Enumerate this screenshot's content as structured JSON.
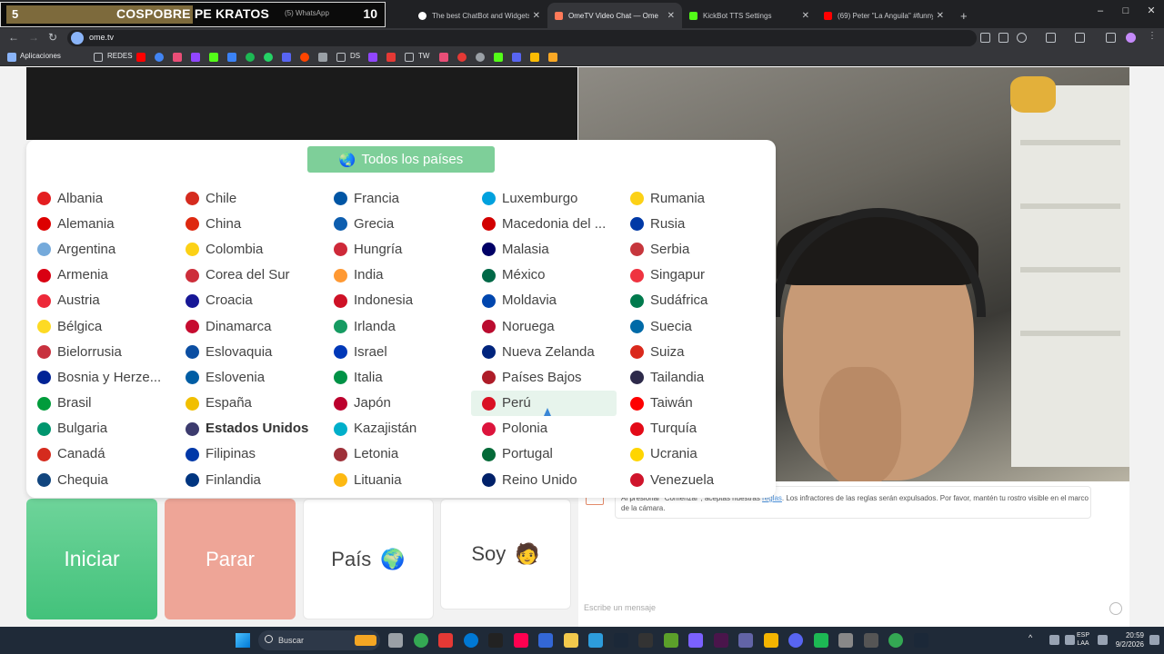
{
  "browser": {
    "tabs": [
      {
        "title": "The best ChatBot and Widgets",
        "fav_color": "#ffffff"
      },
      {
        "title": "OmeTV Video Chat — Ome",
        "fav_color": "#ff7a59",
        "active": true
      },
      {
        "title": "KickBot TTS Settings",
        "fav_color": "#53fc18"
      },
      {
        "title": "(69) Peter \"La Anguila\" #funny",
        "fav_color": "#ff0000"
      }
    ],
    "new_tab": "+",
    "url": "ome.tv",
    "window_controls": [
      "–",
      "□",
      "✕"
    ]
  },
  "stream_overlay": {
    "left_number": "5",
    "title": "COSPOBRE PE KRATOS",
    "whatsapp": "(5) WhatsApp",
    "right_number": "10"
  },
  "bookmarks": {
    "apps": "Aplicaciones",
    "folders": [
      "REDES",
      "DS",
      "TW"
    ]
  },
  "country_selector": {
    "all_button": "Todos los países",
    "all_icon": "🌏",
    "columns": [
      [
        {
          "name": "Albania",
          "flag": "#e41e20"
        },
        {
          "name": "Alemania",
          "flag": "#dd0000"
        },
        {
          "name": "Argentina",
          "flag": "#75aadb"
        },
        {
          "name": "Armenia",
          "flag": "#d90012"
        },
        {
          "name": "Austria",
          "flag": "#ed2939"
        },
        {
          "name": "Bélgica",
          "flag": "#fdda24"
        },
        {
          "name": "Bielorrusia",
          "flag": "#c8313e"
        },
        {
          "name": "Bosnia y Herze...",
          "flag": "#002395"
        },
        {
          "name": "Brasil",
          "flag": "#009c3b"
        },
        {
          "name": "Bulgaria",
          "flag": "#00966e"
        },
        {
          "name": "Canadá",
          "flag": "#d52b1e"
        },
        {
          "name": "Chequia",
          "flag": "#11457e"
        }
      ],
      [
        {
          "name": "Chile",
          "flag": "#d52b1e"
        },
        {
          "name": "China",
          "flag": "#de2910"
        },
        {
          "name": "Colombia",
          "flag": "#fcd116"
        },
        {
          "name": "Corea del Sur",
          "flag": "#cd2e3a"
        },
        {
          "name": "Croacia",
          "flag": "#171796"
        },
        {
          "name": "Dinamarca",
          "flag": "#c60c30"
        },
        {
          "name": "Eslovaquia",
          "flag": "#0b4ea2"
        },
        {
          "name": "Eslovenia",
          "flag": "#005da4"
        },
        {
          "name": "España",
          "flag": "#f1bf00"
        },
        {
          "name": "Estados Unidos",
          "flag": "#3c3b6e",
          "bold": true
        },
        {
          "name": "Filipinas",
          "flag": "#0038a8"
        },
        {
          "name": "Finlandia",
          "flag": "#003580"
        }
      ],
      [
        {
          "name": "Francia",
          "flag": "#0055a4"
        },
        {
          "name": "Grecia",
          "flag": "#0d5eaf"
        },
        {
          "name": "Hungría",
          "flag": "#ce2939"
        },
        {
          "name": "India",
          "flag": "#ff9933"
        },
        {
          "name": "Indonesia",
          "flag": "#ce1126"
        },
        {
          "name": "Irlanda",
          "flag": "#169b62"
        },
        {
          "name": "Israel",
          "flag": "#0038b8"
        },
        {
          "name": "Italia",
          "flag": "#009246"
        },
        {
          "name": "Japón",
          "flag": "#bc002d"
        },
        {
          "name": "Kazajistán",
          "flag": "#00afca"
        },
        {
          "name": "Letonia",
          "flag": "#9e3039"
        },
        {
          "name": "Lituania",
          "flag": "#fdb913"
        }
      ],
      [
        {
          "name": "Luxemburgo",
          "flag": "#00a1de"
        },
        {
          "name": "Macedonia del ...",
          "flag": "#d20000"
        },
        {
          "name": "Malasia",
          "flag": "#010066"
        },
        {
          "name": "México",
          "flag": "#006847"
        },
        {
          "name": "Moldavia",
          "flag": "#0046ae"
        },
        {
          "name": "Noruega",
          "flag": "#ba0c2f"
        },
        {
          "name": "Nueva Zelanda",
          "flag": "#00247d"
        },
        {
          "name": "Países Bajos",
          "flag": "#ae1c28"
        },
        {
          "name": "Perú",
          "flag": "#d91023",
          "highlight": true
        },
        {
          "name": "Polonia",
          "flag": "#dc143c"
        },
        {
          "name": "Portugal",
          "flag": "#046a38"
        },
        {
          "name": "Reino Unido",
          "flag": "#012169"
        }
      ],
      [
        {
          "name": "Rumania",
          "flag": "#fcd116"
        },
        {
          "name": "Rusia",
          "flag": "#0039a6"
        },
        {
          "name": "Serbia",
          "flag": "#c6363c"
        },
        {
          "name": "Singapur",
          "flag": "#ef3340"
        },
        {
          "name": "Sudáfrica",
          "flag": "#007a4d"
        },
        {
          "name": "Suecia",
          "flag": "#006aa7"
        },
        {
          "name": "Suiza",
          "flag": "#da291c"
        },
        {
          "name": "Tailandia",
          "flag": "#2d2a4a"
        },
        {
          "name": "Taiwán",
          "flag": "#fe0000"
        },
        {
          "name": "Turquía",
          "flag": "#e30a17"
        },
        {
          "name": "Ucrania",
          "flag": "#ffd500"
        },
        {
          "name": "Venezuela",
          "flag": "#cf142b"
        }
      ]
    ]
  },
  "controls": {
    "start": "Iniciar",
    "stop": "Parar",
    "country": "País",
    "country_icon": "🌍",
    "gender": "Soy",
    "gender_icon": "🧑"
  },
  "chat": {
    "notice_prefix": "Al presionar \"Comenzar\", aceptas nuestras",
    "notice_link": "reglas",
    "notice_suffix": ". Los infractores de las reglas serán expulsados. Por favor, mantén tu rostro visible en el marco de la cámara.",
    "input_placeholder": "Escribe un mensaje"
  },
  "taskbar": {
    "search": "Buscar",
    "lang_top": "ESP",
    "lang_bottom": "LAA",
    "time": "20:59",
    "date": "9/2/2026"
  },
  "colors": {
    "accent_green": "#7ecf99",
    "start_green": "#43c27b",
    "stop_salmon": "#eea597",
    "highlight_row": "#e7f4ec"
  }
}
